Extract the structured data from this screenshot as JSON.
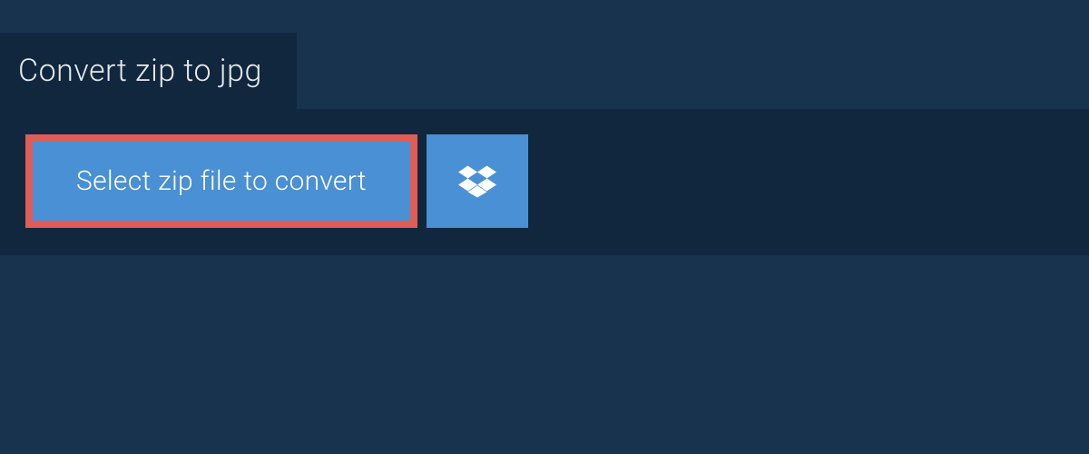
{
  "header": {
    "title": "Convert zip to jpg"
  },
  "actions": {
    "select_file_label": "Select zip file to convert",
    "dropbox_icon": "dropbox-icon"
  },
  "colors": {
    "background_outer": "#17334e",
    "background_inner": "#10273e",
    "button_primary": "#4990d4",
    "highlight_border": "#e15c57",
    "text_light": "#ffffff"
  }
}
